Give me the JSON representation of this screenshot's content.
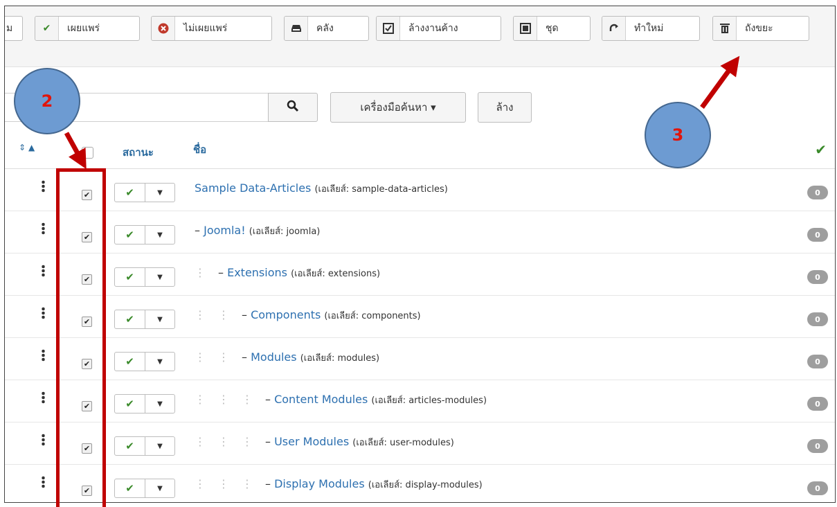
{
  "toolbar": {
    "buttons": [
      {
        "label": "",
        "icon": "partial-button"
      },
      {
        "label": "เผยแพร่",
        "icon": "check-icon"
      },
      {
        "label": "ไม่เผยแพร่",
        "icon": "times-circle-icon"
      },
      {
        "label": "คลัง",
        "icon": "archive-icon"
      },
      {
        "label": "ล้างงานค้าง",
        "icon": "checkbox-icon"
      },
      {
        "label": "ชุด",
        "icon": "batch-icon"
      },
      {
        "label": "ทำใหม่",
        "icon": "refresh-icon"
      },
      {
        "label": "ถังขยะ",
        "icon": "trash-icon"
      }
    ]
  },
  "search": {
    "placeholder": "",
    "tools_label": "เครื่องมือค้นหา ▾",
    "clear_label": "ล้าง"
  },
  "table": {
    "headers": {
      "status": "สถานะ",
      "name": "ชื่อ"
    },
    "rows": [
      {
        "level": 0,
        "title": "Sample Data-Articles",
        "alias": "(เอเลียส์: sample-data-articles)",
        "count": "0",
        "checked": true
      },
      {
        "level": 1,
        "title": "Joomla!",
        "alias": "(เอเลียส์: joomla)",
        "count": "0",
        "checked": true
      },
      {
        "level": 2,
        "title": "Extensions",
        "alias": "(เอเลียส์: extensions)",
        "count": "0",
        "checked": true
      },
      {
        "level": 3,
        "title": "Components",
        "alias": "(เอเลียส์: components)",
        "count": "0",
        "checked": true
      },
      {
        "level": 3,
        "title": "Modules",
        "alias": "(เอเลียส์: modules)",
        "count": "0",
        "checked": true
      },
      {
        "level": 4,
        "title": "Content Modules",
        "alias": "(เอเลียส์: articles-modules)",
        "count": "0",
        "checked": true
      },
      {
        "level": 4,
        "title": "User Modules",
        "alias": "(เอเลียส์: user-modules)",
        "count": "0",
        "checked": true
      },
      {
        "level": 4,
        "title": "Display Modules",
        "alias": "(เอเลียส์: display-modules)",
        "count": "0",
        "checked": true
      }
    ]
  },
  "annotations": {
    "step2": "2",
    "step3": "3"
  },
  "colors": {
    "link": "#2d70b0",
    "published": "#3a8a2a",
    "annotation_red": "#c00000",
    "annotation_circle": "#6d9bd2"
  }
}
